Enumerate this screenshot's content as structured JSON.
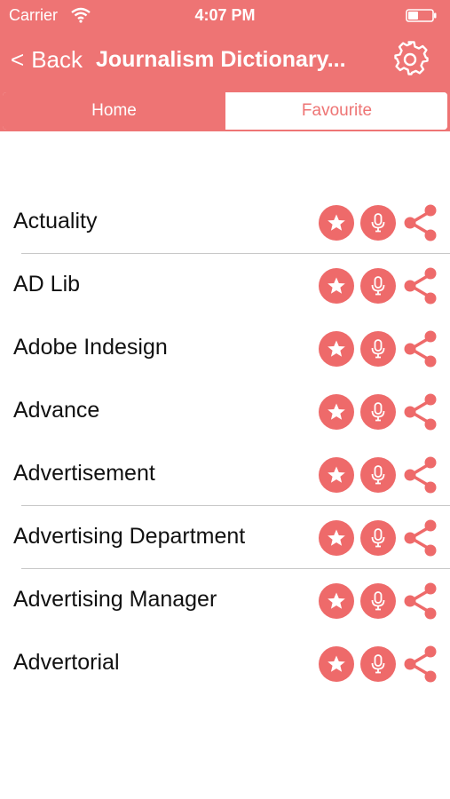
{
  "status_bar": {
    "carrier": "Carrier",
    "time": "4:07 PM"
  },
  "nav": {
    "back_chevron": "<",
    "back_label": "Back",
    "title": "Journalism Dictionary..."
  },
  "tabs": [
    {
      "label": "Home",
      "selected": true
    },
    {
      "label": "Favourite",
      "selected": false
    }
  ],
  "terms": [
    "Actuality",
    "AD Lib",
    "Adobe Indesign",
    "Advance",
    "Advertisement",
    "Advertising Department",
    "Advertising Manager",
    "Advertorial"
  ],
  "row_icons": [
    "star-icon",
    "microphone-icon",
    "share-icon"
  ],
  "colors": {
    "accent": "#ee7474",
    "button": "#ee6a6a",
    "text": "#111111",
    "divider": "#c8c8c8"
  }
}
